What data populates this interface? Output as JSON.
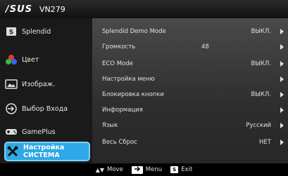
{
  "header": {
    "brand": "/SUS",
    "model": "VN279"
  },
  "sidebar": {
    "items": [
      {
        "label": "Splendid",
        "icon": "splendid-icon"
      },
      {
        "label": "Цвет",
        "icon": "color-icon"
      },
      {
        "label": "Изображ.",
        "icon": "image-icon"
      },
      {
        "label": "Выбор Входа",
        "icon": "input-select-icon"
      },
      {
        "label": "GamePlus",
        "icon": "gameplus-icon"
      },
      {
        "label": "Настройка СИСТЕМА",
        "icon": "system-setup-icon",
        "active": true
      }
    ]
  },
  "menu": {
    "rows": [
      {
        "label": "Splendid Demo Mode",
        "value": "ВЫКЛ."
      },
      {
        "label": "Громкость",
        "value": "48"
      },
      {
        "label": "ECO Mode",
        "value": "ВЫКЛ."
      },
      {
        "label": "Настройка меню",
        "value": ""
      },
      {
        "label": "Блокировка кнопки",
        "value": "ВЫКЛ."
      },
      {
        "label": "Информация",
        "value": ""
      },
      {
        "label": "Язык",
        "value": "Русский"
      },
      {
        "label": "Весь Сброс",
        "value": "НЕТ"
      }
    ]
  },
  "footer": {
    "move_label": "Move",
    "menu_key": "",
    "menu_label": "Menu",
    "exit_key": "S",
    "exit_label": "Exit"
  },
  "colors": {
    "accent": "#2ea8e6"
  }
}
